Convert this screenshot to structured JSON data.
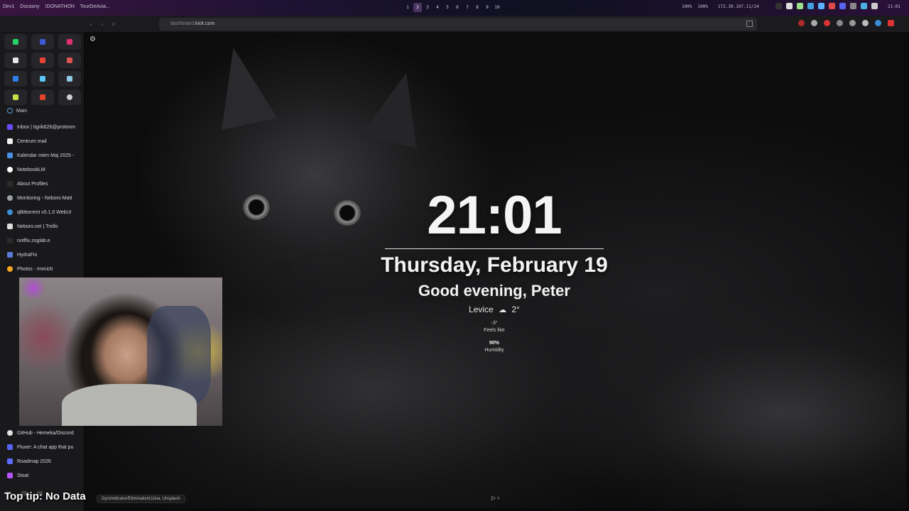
{
  "topbar": {
    "window_title": [
      "Dev1",
      "Docasny",
      "!DONATHON",
      "TourDeAsia..."
    ],
    "workspaces": [
      "1",
      "2",
      "3",
      "4",
      "5",
      "6",
      "7",
      "8",
      "9",
      "10"
    ],
    "active_workspace": "2",
    "volume": "100%",
    "mic": "100%",
    "ip": "172.30.197.11/24",
    "clock": "21:01"
  },
  "browser": {
    "url_domain": "dashboard.",
    "url_host": "kick.com"
  },
  "sidebar": {
    "pins": [
      {
        "icon": "whatsapp-icon",
        "color": "#25d366"
      },
      {
        "icon": "messenger-icon",
        "color": "#3b5bdb"
      },
      {
        "icon": "instagram-icon",
        "color": "#e1306c"
      },
      {
        "icon": "x-icon",
        "color": "#e6e6e6"
      },
      {
        "icon": "gmail-icon",
        "color": "#ea4335"
      },
      {
        "icon": "gmail-icon",
        "color": "#d9534f"
      },
      {
        "icon": "chat-icon",
        "color": "#2f80ed"
      },
      {
        "icon": "cloud-icon",
        "color": "#5ac8fa"
      },
      {
        "icon": "message-icon",
        "color": "#8ecae6"
      },
      {
        "icon": "notes-icon",
        "color": "#c6e04a"
      },
      {
        "icon": "gitlab-icon",
        "color": "#e24329"
      },
      {
        "icon": "github-icon",
        "color": "#d0d0d0"
      }
    ],
    "space_label": "Main",
    "tabs": [
      {
        "label": "Inbox | tigrik626@protonm",
        "color": "#6d4aff"
      },
      {
        "label": "Centrum mail",
        "color": "#f0f0f0"
      },
      {
        "label": "Kalendar mien Maj 2025 - ",
        "color": "#4a90e2"
      },
      {
        "label": "NotebookLM",
        "color": "#ffffff"
      },
      {
        "label": "About Profiles",
        "color": "#2b2b2b"
      },
      {
        "label": "Monitoring - Neboro Matt",
        "color": "#9aa0a6"
      },
      {
        "label": "qBittorrent v5.1.0 WebUI",
        "color": "#3b8ed6"
      },
      {
        "label": "Neboro.net | Trello",
        "color": "#dcdcdc"
      },
      {
        "label": "notflix.zoglab.e",
        "color": "#2b2b2b"
      },
      {
        "label": "HydraFin",
        "color": "#5a7bd8"
      },
      {
        "label": "Photos - Immich",
        "color": "#f5a623"
      }
    ],
    "tabs_bottom": [
      {
        "label": "GitHub - Hemeka/Discord",
        "color": "#e0e0e0"
      },
      {
        "label": "Fluxer: A chat app that pu",
        "color": "#5865f2"
      },
      {
        "label": "Roadmap 2026",
        "color": "#5b6cff"
      },
      {
        "label": "Stoat",
        "color": "#b455ff"
      }
    ]
  },
  "dashboard": {
    "time": "21:01",
    "date": "Thursday, February 19",
    "greeting": "Good evening, Peter",
    "location": "Levice",
    "temperature": "2°",
    "feels_like_value": "-3°",
    "feels_like_label": "Feels like",
    "humidity_value": "90%",
    "humidity_label": "Humidity"
  },
  "status_bar": "GyroIndicator/EliminationUzina, Unsplash",
  "top_tip": "Top tip: No Data"
}
